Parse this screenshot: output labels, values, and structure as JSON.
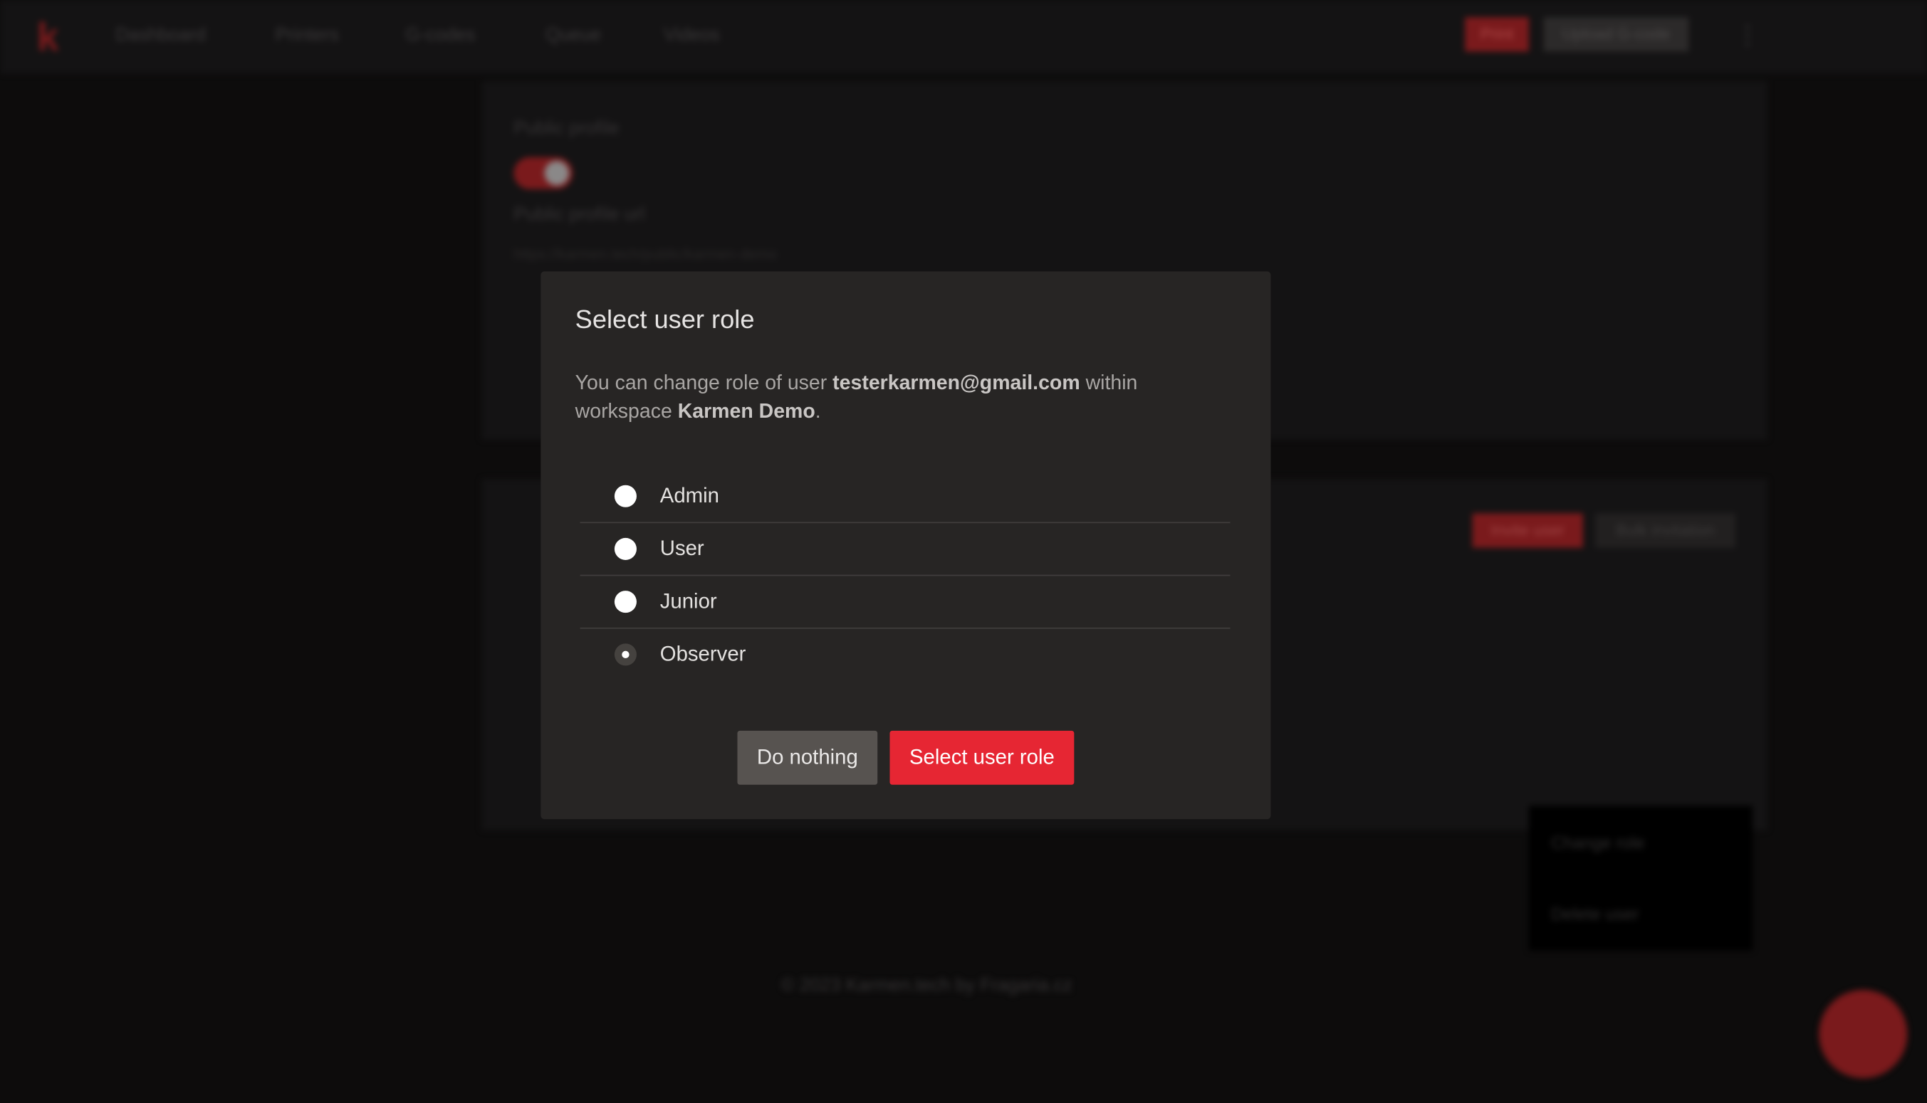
{
  "background": {
    "logo": "k",
    "nav": [
      "Dashboard",
      "Printers",
      "G-codes",
      "Queue",
      "Videos"
    ],
    "print_label": "Print",
    "upload_label": "Upload G-code",
    "public_profile_label": "Public profile",
    "public_profile_enabled": true,
    "public_profile_url_label": "Public profile url",
    "public_profile_url": "https://karmen.tech/public/karmen-demo",
    "invite_user_label": "Invite user",
    "bulk_invitation_label": "Bulk invitation",
    "context_menu": [
      "Change role",
      "Delete user"
    ],
    "footer": "© 2023 Karmen.tech by Fragaria.cz"
  },
  "modal": {
    "title": "Select user role",
    "desc_prefix": "You can change role of user ",
    "user_email": "testerkarmen@gmail.com",
    "desc_middle": " within workspace ",
    "workspace": "Karmen Demo",
    "desc_suffix": ".",
    "roles": [
      {
        "label": "Admin",
        "selected": false
      },
      {
        "label": "User",
        "selected": false
      },
      {
        "label": "Junior",
        "selected": false
      },
      {
        "label": "Observer",
        "selected": true
      }
    ],
    "cancel_label": "Do nothing",
    "confirm_label": "Select user role"
  },
  "colors": {
    "accent": "#e62633",
    "modal_bg": "#272524"
  }
}
